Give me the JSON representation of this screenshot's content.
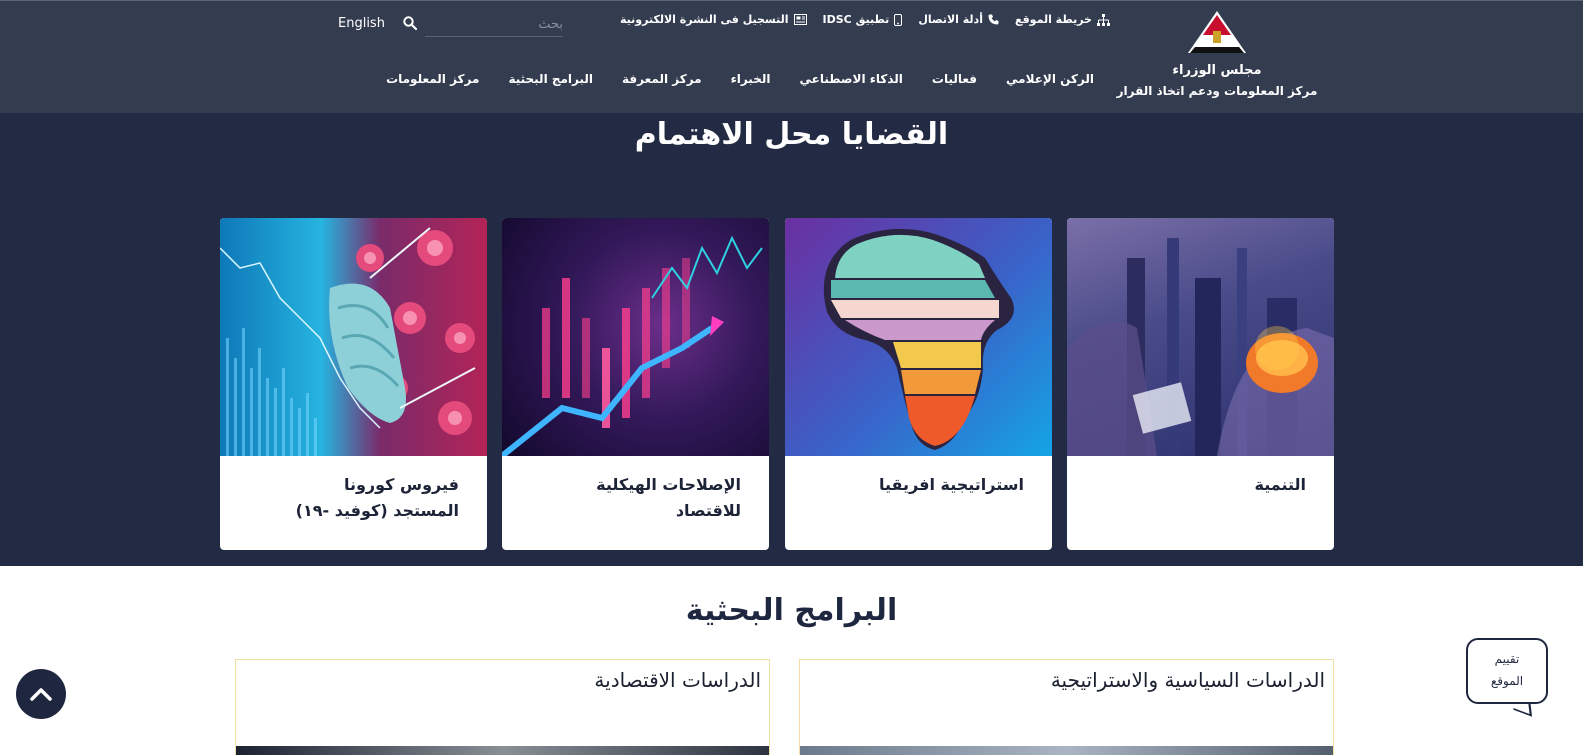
{
  "header": {
    "logo_line1": "مجلس الوزراء",
    "logo_line2": "مركز المعلومات ودعم اتخاذ القرار",
    "top_links": [
      {
        "label": "التسجيل فى النشرة الالكترونية",
        "icon": "newsletter-icon"
      },
      {
        "label": "تطبيق IDSC",
        "icon": "mobile-icon"
      },
      {
        "label": "أدلة الاتصال",
        "icon": "phone-icon"
      },
      {
        "label": "خريطة الموقع",
        "icon": "sitemap-icon"
      }
    ],
    "search_placeholder": "بحث",
    "language": "English",
    "nav": [
      "مركز المعلومات",
      "البرامج البحثية",
      "مركز المعرفة",
      "الخبراء",
      "الذكاء الاصطناعي",
      "فعاليات",
      "الركن الإعلامي"
    ]
  },
  "issues": {
    "title": "القضايا محل الاهتمام",
    "cards": [
      {
        "line1": "التنمية",
        "line2": ""
      },
      {
        "line1": "استراتيجية افريقيا",
        "line2": ""
      },
      {
        "line1": "الإصلاحات الهيكلية",
        "line2": "للاقتصاد"
      },
      {
        "line1": "فيروس كورونا",
        "line2": "المستجد (كوفيد -١٩)"
      }
    ]
  },
  "research": {
    "title": "البرامج البحثية",
    "cards": [
      {
        "label": "الدراسات السياسية والاستراتيجية"
      },
      {
        "label": "الدراسات الاقتصادية"
      }
    ]
  },
  "floating": {
    "rate_line1": "تقييم",
    "rate_line2": "الموقع"
  },
  "colors": {
    "header_bg": "#343c50",
    "issues_bg": "#232b44",
    "accent_dark": "#1f2740",
    "research_border": "#f1dfa6"
  }
}
